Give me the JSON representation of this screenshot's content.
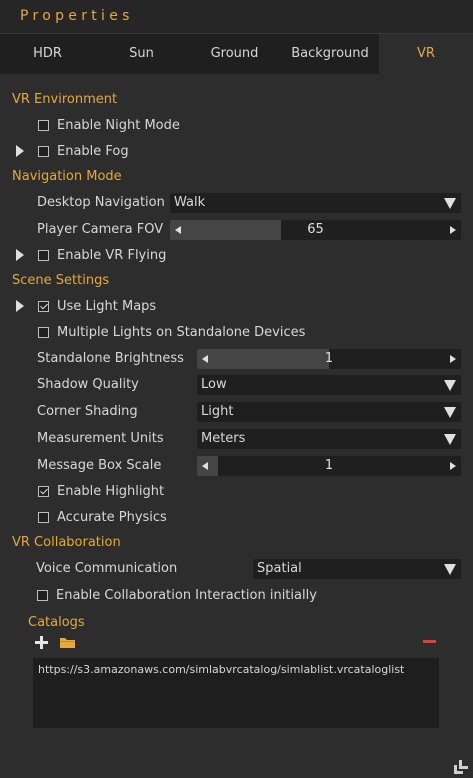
{
  "window": {
    "title": "Properties"
  },
  "tabs": [
    {
      "label": "HDR"
    },
    {
      "label": "Sun"
    },
    {
      "label": "Ground"
    },
    {
      "label": "Background"
    },
    {
      "label": "VR",
      "active": true
    }
  ],
  "vr_environment": {
    "heading": "VR Environment",
    "night_mode": {
      "label": "Enable Night Mode",
      "checked": false
    },
    "fog": {
      "label": "Enable Fog",
      "checked": false
    }
  },
  "navigation": {
    "heading": "Navigation Mode",
    "desktop_navigation": {
      "label": "Desktop Navigation",
      "value": "Walk"
    },
    "player_fov": {
      "label": "Player Camera FOV",
      "value": "65",
      "fill_fraction": 0.38
    },
    "vr_flying": {
      "label": "Enable VR Flying",
      "checked": false
    }
  },
  "scene": {
    "heading": "Scene Settings",
    "light_maps": {
      "label": "Use Light Maps",
      "checked": true
    },
    "multiple_lights": {
      "label": "Multiple Lights on Standalone Devices",
      "checked": false
    },
    "standalone_brightness": {
      "label": "Standalone Brightness",
      "value": "1",
      "fill_fraction": 0.5
    },
    "shadow_quality": {
      "label": "Shadow Quality",
      "value": "Low"
    },
    "corner_shading": {
      "label": "Corner Shading",
      "value": "Light"
    },
    "measurement_units": {
      "label": "Measurement Units",
      "value": "Meters"
    },
    "message_box_scale": {
      "label": "Message Box Scale",
      "value": "1",
      "fill_fraction": 0.08
    },
    "highlight": {
      "label": "Enable Highlight",
      "checked": true
    },
    "accurate_physics": {
      "label": "Accurate Physics",
      "checked": false
    }
  },
  "collaboration": {
    "heading": "VR Collaboration",
    "voice": {
      "label": "Voice Communication",
      "value": "Spatial"
    },
    "interaction": {
      "label": "Enable Collaboration Interaction initially",
      "checked": false
    }
  },
  "catalogs": {
    "heading": "Catalogs",
    "items": [
      "https://s3.amazonaws.com/simlabvrcatalog/simlablist.vrcataloglist"
    ]
  },
  "colors": {
    "accent": "#e6a93a",
    "remove": "#d9413a",
    "panel": "#2d2d2d",
    "field": "#1f1f1f"
  }
}
